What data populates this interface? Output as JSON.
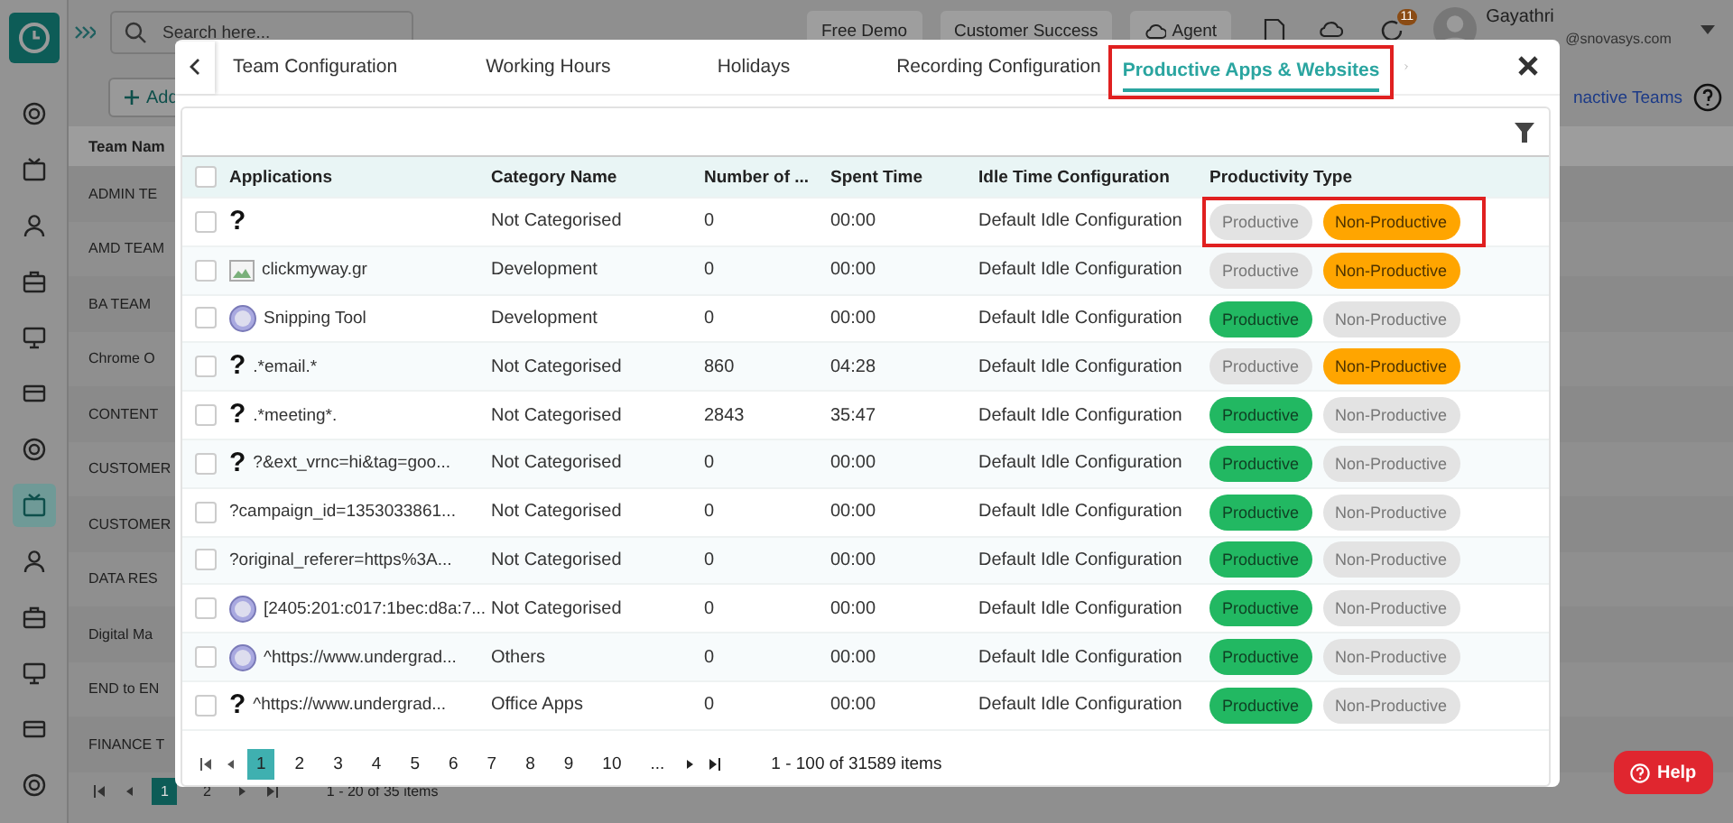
{
  "topbar": {
    "search": {
      "placeholder": "Search here..."
    },
    "buttons": [
      "Free Demo",
      "Customer Success",
      "Agent"
    ],
    "notification_count": "11",
    "user": {
      "name": "Gayathri",
      "email": "@snovasys.com"
    }
  },
  "sidebar": {
    "items": [
      {
        "selected": false
      },
      {
        "selected": false
      },
      {
        "selected": false
      },
      {
        "selected": false
      },
      {
        "selected": false
      },
      {
        "selected": false
      },
      {
        "selected": false
      },
      {
        "selected": true
      },
      {
        "selected": false
      },
      {
        "selected": false
      },
      {
        "selected": false
      },
      {
        "selected": false
      },
      {
        "selected": false
      }
    ]
  },
  "background_page": {
    "add_button": "Add",
    "inactive_link": "nactive Teams",
    "column": "Team Nam",
    "rows": [
      "ADMIN TE",
      "AMD TEAM",
      "BA TEAM",
      "Chrome O",
      "CONTENT",
      "CUSTOMER",
      "CUSTOMER",
      "DATA RES",
      "Digital Ma",
      "END to EN",
      "FINANCE T"
    ],
    "pages": [
      {
        "label": "1",
        "selected": true
      },
      {
        "label": "2",
        "selected": false
      }
    ],
    "summary": "1 - 20 of 35 items"
  },
  "dialog": {
    "tabs": [
      {
        "label": "Team Configuration",
        "selected": false,
        "highlighted": false
      },
      {
        "label": "Working Hours",
        "selected": false,
        "highlighted": false
      },
      {
        "label": "Holidays",
        "selected": false,
        "highlighted": false
      },
      {
        "label": "Recording Configuration",
        "selected": false,
        "highlighted": false
      },
      {
        "label": "Productive Apps & Websites",
        "selected": true,
        "highlighted": true
      }
    ],
    "table": {
      "select_all_checked": false,
      "columns": [
        "Applications",
        "Category Name",
        "Number of ...",
        "Spent Time",
        "Idle Time Configuration",
        "Productivity Type"
      ],
      "rows": [
        {
          "kind": "question",
          "icon": "?",
          "app": "",
          "category": "Not Categorised",
          "count": "0",
          "time": "00:00",
          "idle": "Default Idle Configuration",
          "checked": false,
          "highlighted": true,
          "types": [
            {
              "label": "Productive",
              "selected": false
            },
            {
              "label": "Non-Productive",
              "selected": true
            }
          ]
        },
        {
          "kind": "broken",
          "app": "clickmyway.gr",
          "category": "Development",
          "count": "0",
          "time": "00:00",
          "idle": "Default Idle Configuration",
          "checked": false,
          "highlighted": false,
          "types": [
            {
              "label": "Productive",
              "selected": false
            },
            {
              "label": "Non-Productive",
              "selected": true
            }
          ]
        },
        {
          "kind": "globe",
          "app": "Snipping Tool",
          "category": "Development",
          "count": "0",
          "time": "00:00",
          "idle": "Default Idle Configuration",
          "checked": false,
          "highlighted": false,
          "types": [
            {
              "label": "Productive",
              "selected": true
            },
            {
              "label": "Non-Productive",
              "selected": false
            }
          ]
        },
        {
          "kind": "question",
          "icon": "?",
          "app": ".*email.*",
          "category": "Not Categorised",
          "count": "860",
          "time": "04:28",
          "idle": "Default Idle Configuration",
          "checked": false,
          "highlighted": false,
          "types": [
            {
              "label": "Productive",
              "selected": false
            },
            {
              "label": "Non-Productive",
              "selected": true
            }
          ]
        },
        {
          "kind": "question",
          "icon": "?",
          "app": ".*meeting*.",
          "category": "Not Categorised",
          "count": "2843",
          "time": "35:47",
          "idle": "Default Idle Configuration",
          "checked": false,
          "highlighted": false,
          "types": [
            {
              "label": "Productive",
              "selected": true
            },
            {
              "label": "Non-Productive",
              "selected": false
            }
          ]
        },
        {
          "kind": "question",
          "icon": "?",
          "app": "?&ext_vrnc=hi&tag=goo...",
          "category": "Not Categorised",
          "count": "0",
          "time": "00:00",
          "idle": "Default Idle Configuration",
          "checked": false,
          "highlighted": false,
          "types": [
            {
              "label": "Productive",
              "selected": true
            },
            {
              "label": "Non-Productive",
              "selected": false
            }
          ]
        },
        {
          "kind": "plain",
          "app": "?campaign_id=1353033861...",
          "category": "Not Categorised",
          "count": "0",
          "time": "00:00",
          "idle": "Default Idle Configuration",
          "checked": false,
          "highlighted": false,
          "types": [
            {
              "label": "Productive",
              "selected": true
            },
            {
              "label": "Non-Productive",
              "selected": false
            }
          ]
        },
        {
          "kind": "plain",
          "app": "?original_referer=https%3A...",
          "category": "Not Categorised",
          "count": "0",
          "time": "00:00",
          "idle": "Default Idle Configuration",
          "checked": false,
          "highlighted": false,
          "types": [
            {
              "label": "Productive",
              "selected": true
            },
            {
              "label": "Non-Productive",
              "selected": false
            }
          ]
        },
        {
          "kind": "globe",
          "app": "[2405:201:c017:1bec:d8a:7...",
          "category": "Not Categorised",
          "count": "0",
          "time": "00:00",
          "idle": "Default Idle Configuration",
          "checked": false,
          "highlighted": false,
          "types": [
            {
              "label": "Productive",
              "selected": true
            },
            {
              "label": "Non-Productive",
              "selected": false
            }
          ]
        },
        {
          "kind": "globe",
          "app": "^https://www.undergrad...",
          "category": "Others",
          "count": "0",
          "time": "00:00",
          "idle": "Default Idle Configuration",
          "checked": false,
          "highlighted": false,
          "types": [
            {
              "label": "Productive",
              "selected": true
            },
            {
              "label": "Non-Productive",
              "selected": false
            }
          ]
        },
        {
          "kind": "question",
          "icon": "?",
          "app": "^https://www.undergrad...",
          "category": "Office Apps",
          "count": "0",
          "time": "00:00",
          "idle": "Default Idle Configuration",
          "checked": false,
          "highlighted": false,
          "types": [
            {
              "label": "Productive",
              "selected": true
            },
            {
              "label": "Non-Productive",
              "selected": false
            }
          ]
        }
      ]
    },
    "pagination": {
      "pages": [
        {
          "label": "1",
          "selected": true
        },
        {
          "label": "2",
          "selected": false
        },
        {
          "label": "3",
          "selected": false
        },
        {
          "label": "4",
          "selected": false
        },
        {
          "label": "5",
          "selected": false
        },
        {
          "label": "6",
          "selected": false
        },
        {
          "label": "7",
          "selected": false
        },
        {
          "label": "8",
          "selected": false
        },
        {
          "label": "9",
          "selected": false
        },
        {
          "label": "10",
          "selected": false
        },
        {
          "label": "...",
          "selected": false
        }
      ],
      "summary": "1 - 100 of 31589 items"
    }
  },
  "help_button": "Help"
}
